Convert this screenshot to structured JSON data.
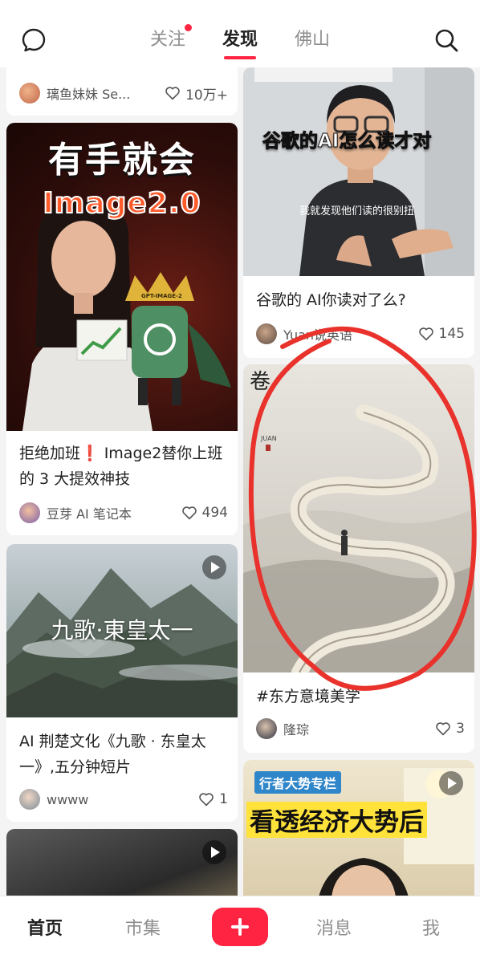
{
  "header": {
    "tabs": [
      {
        "label": "关注"
      },
      {
        "label": "发现"
      },
      {
        "label": "佛山"
      }
    ]
  },
  "feed": {
    "cards": [
      {
        "title": "",
        "author": "璃鱼妹妹 Se...",
        "likes": "10万+"
      },
      {
        "title": "谷歌的 AI你读对了么?",
        "author": "Yuan说英语",
        "likes": "145",
        "cover_text": "谷歌的AI怎么读才对",
        "cover_subtitle": "我就发现他们读的很别扭"
      },
      {
        "title": "拒绝加班❗ Image2替你上班的 3 大提效神技",
        "author": "豆芽 AI 笔记本",
        "likes": "494",
        "cover_text": "有手就会",
        "cover_text2": "Image2.0",
        "cover_badge": "GPT-IMAGE-2"
      },
      {
        "title": "#东方意境美学",
        "author": "隆琮",
        "likes": "3",
        "cover_text": "JUAN"
      },
      {
        "title": "AI 荆楚文化《九歌 · 东皇太一》,五分钟短片",
        "author": "wwww",
        "likes": "1",
        "cover_text": "九歌·東皇太一"
      },
      {
        "title": "",
        "author": "",
        "likes": "",
        "cover_text": "行者大势专栏",
        "cover_text2": "看透经济大势后"
      },
      {
        "title": "",
        "author": "",
        "likes": ""
      }
    ]
  },
  "bottom_nav": {
    "items": [
      {
        "label": "首页"
      },
      {
        "label": "市集"
      },
      {
        "label": "消息"
      },
      {
        "label": "我"
      }
    ]
  },
  "colors": {
    "accent": "#ff2442",
    "annotation": "#e8322b"
  }
}
